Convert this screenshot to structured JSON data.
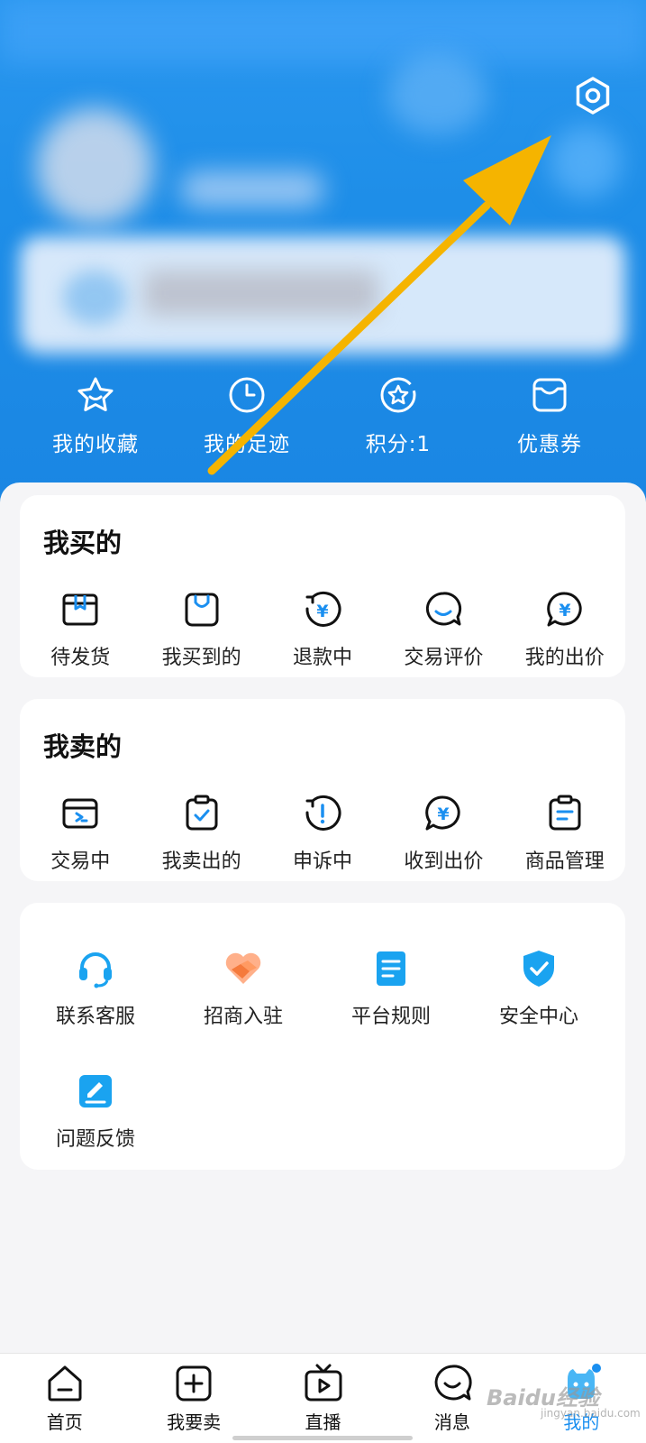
{
  "header": {
    "settings_icon": "hexagon-gear-icon",
    "quick_links": [
      {
        "label": "我的收藏",
        "icon": "star-icon"
      },
      {
        "label": "我的足迹",
        "icon": "clock-icon"
      },
      {
        "label": "积分:1",
        "icon": "badge-star-icon"
      },
      {
        "label": "优惠券",
        "icon": "coupon-icon"
      }
    ]
  },
  "buying": {
    "title": "我买的",
    "items": [
      {
        "label": "待发货",
        "icon": "package-icon"
      },
      {
        "label": "我买到的",
        "icon": "shopping-bag-icon"
      },
      {
        "label": "退款中",
        "icon": "refund-icon"
      },
      {
        "label": "交易评价",
        "icon": "comment-icon"
      },
      {
        "label": "我的出价",
        "icon": "yuan-bubble-icon"
      }
    ]
  },
  "selling": {
    "title": "我卖的",
    "items": [
      {
        "label": "交易中",
        "icon": "wallet-icon"
      },
      {
        "label": "我卖出的",
        "icon": "clipboard-check-icon"
      },
      {
        "label": "申诉中",
        "icon": "alert-icon"
      },
      {
        "label": "收到出价",
        "icon": "yuan-bubble-icon"
      },
      {
        "label": "商品管理",
        "icon": "clipboard-list-icon"
      }
    ]
  },
  "services": {
    "items": [
      {
        "label": "联系客服",
        "icon": "headset-icon"
      },
      {
        "label": "招商入驻",
        "icon": "handshake-icon"
      },
      {
        "label": "平台规则",
        "icon": "document-icon"
      },
      {
        "label": "安全中心",
        "icon": "shield-check-icon"
      },
      {
        "label": "问题反馈",
        "icon": "edit-icon"
      }
    ]
  },
  "bottom_nav": {
    "items": [
      {
        "label": "首页",
        "icon": "home-icon"
      },
      {
        "label": "我要卖",
        "icon": "plus-square-icon"
      },
      {
        "label": "直播",
        "icon": "tv-play-icon"
      },
      {
        "label": "消息",
        "icon": "chat-icon"
      },
      {
        "label": "我的",
        "icon": "mascot-icon"
      }
    ],
    "active": "我的"
  },
  "watermark": {
    "text": "Baidu经验",
    "sub": "jingyan.baidu.com"
  },
  "colors": {
    "accent": "#1a8ff0",
    "header_blue": "#1e8ee8",
    "arrow": "#f5b400"
  }
}
